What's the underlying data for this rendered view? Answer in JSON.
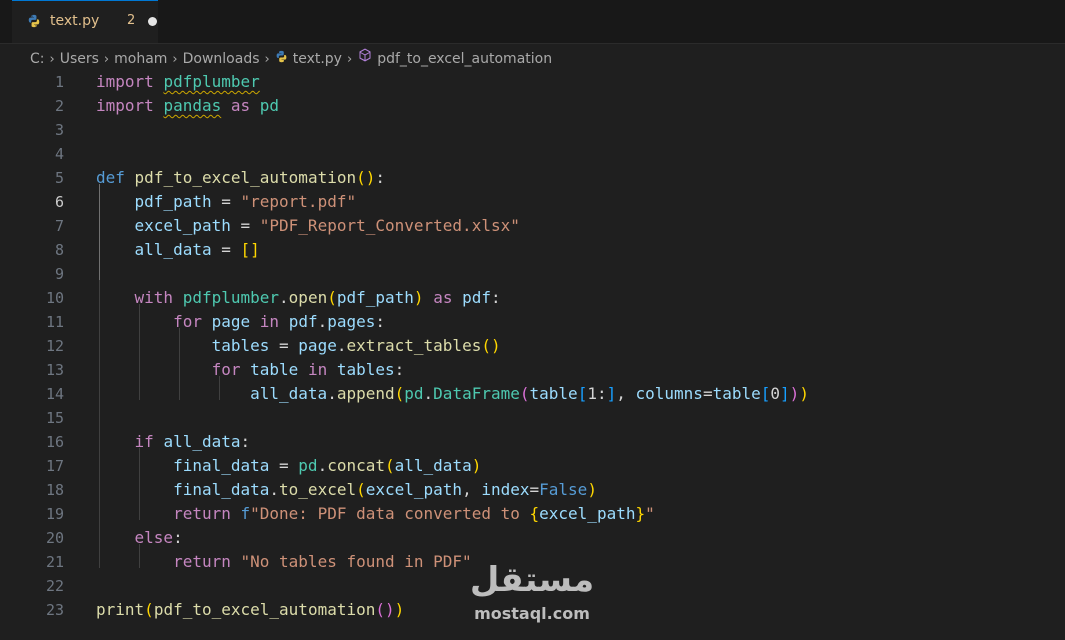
{
  "tab": {
    "filename": "text.py",
    "problem_count": "2"
  },
  "breadcrumb": {
    "items": [
      "C:",
      "Users",
      "moham",
      "Downloads",
      "text.py",
      "pdf_to_excel_automation"
    ]
  },
  "editor": {
    "active_line": 6,
    "line_numbers": [
      "1",
      "2",
      "3",
      "4",
      "5",
      "6",
      "7",
      "8",
      "9",
      "10",
      "11",
      "12",
      "13",
      "14",
      "15",
      "16",
      "17",
      "18",
      "19",
      "20",
      "21",
      "22",
      "23"
    ],
    "lines": [
      [
        [
          "kw",
          "import"
        ],
        [
          "op",
          " "
        ],
        [
          "mod squig",
          "pdfplumber"
        ]
      ],
      [
        [
          "kw",
          "import"
        ],
        [
          "op",
          " "
        ],
        [
          "mod squig",
          "pandas"
        ],
        [
          "op",
          " "
        ],
        [
          "kw",
          "as"
        ],
        [
          "op",
          " "
        ],
        [
          "mod",
          "pd"
        ]
      ],
      [],
      [],
      [
        [
          "def",
          "def"
        ],
        [
          "op",
          " "
        ],
        [
          "fn",
          "pdf_to_excel_automation"
        ],
        [
          "br1",
          "()"
        ],
        [
          "op",
          ":"
        ]
      ],
      [
        [
          "op",
          "    "
        ],
        [
          "var",
          "pdf_path"
        ],
        [
          "op",
          " = "
        ],
        [
          "str",
          "\"report.pdf\""
        ]
      ],
      [
        [
          "op",
          "    "
        ],
        [
          "var",
          "excel_path"
        ],
        [
          "op",
          " = "
        ],
        [
          "str",
          "\"PDF_Report_Converted.xlsx\""
        ]
      ],
      [
        [
          "op",
          "    "
        ],
        [
          "var",
          "all_data"
        ],
        [
          "op",
          " = "
        ],
        [
          "br1",
          "[]"
        ]
      ],
      [],
      [
        [
          "op",
          "    "
        ],
        [
          "kw",
          "with"
        ],
        [
          "op",
          " "
        ],
        [
          "mod",
          "pdfplumber"
        ],
        [
          "op",
          "."
        ],
        [
          "fn",
          "open"
        ],
        [
          "br1",
          "("
        ],
        [
          "var",
          "pdf_path"
        ],
        [
          "br1",
          ")"
        ],
        [
          "op",
          " "
        ],
        [
          "kw",
          "as"
        ],
        [
          "op",
          " "
        ],
        [
          "var",
          "pdf"
        ],
        [
          "op",
          ":"
        ]
      ],
      [
        [
          "op",
          "        "
        ],
        [
          "kw",
          "for"
        ],
        [
          "op",
          " "
        ],
        [
          "var",
          "page"
        ],
        [
          "op",
          " "
        ],
        [
          "kw",
          "in"
        ],
        [
          "op",
          " "
        ],
        [
          "var",
          "pdf"
        ],
        [
          "op",
          "."
        ],
        [
          "var",
          "pages"
        ],
        [
          "op",
          ":"
        ]
      ],
      [
        [
          "op",
          "            "
        ],
        [
          "var",
          "tables"
        ],
        [
          "op",
          " = "
        ],
        [
          "var",
          "page"
        ],
        [
          "op",
          "."
        ],
        [
          "fn",
          "extract_tables"
        ],
        [
          "br1",
          "()"
        ]
      ],
      [
        [
          "op",
          "            "
        ],
        [
          "kw",
          "for"
        ],
        [
          "op",
          " "
        ],
        [
          "var",
          "table"
        ],
        [
          "op",
          " "
        ],
        [
          "kw",
          "in"
        ],
        [
          "op",
          " "
        ],
        [
          "var",
          "tables"
        ],
        [
          "op",
          ":"
        ]
      ],
      [
        [
          "op",
          "                "
        ],
        [
          "var",
          "all_data"
        ],
        [
          "op",
          "."
        ],
        [
          "fn",
          "append"
        ],
        [
          "br1",
          "("
        ],
        [
          "mod",
          "pd"
        ],
        [
          "op",
          "."
        ],
        [
          "mod",
          "DataFrame"
        ],
        [
          "br2",
          "("
        ],
        [
          "var",
          "table"
        ],
        [
          "br3",
          "["
        ],
        [
          "op",
          "1:"
        ],
        [
          "br3",
          "]"
        ],
        [
          "op",
          ", "
        ],
        [
          "var",
          "columns"
        ],
        [
          "op",
          "="
        ],
        [
          "var",
          "table"
        ],
        [
          "br3",
          "["
        ],
        [
          "op",
          "0"
        ],
        [
          "br3",
          "]"
        ],
        [
          "br2",
          ")"
        ],
        [
          "br1",
          ")"
        ]
      ],
      [],
      [
        [
          "op",
          "    "
        ],
        [
          "kw",
          "if"
        ],
        [
          "op",
          " "
        ],
        [
          "var",
          "all_data"
        ],
        [
          "op",
          ":"
        ]
      ],
      [
        [
          "op",
          "        "
        ],
        [
          "var",
          "final_data"
        ],
        [
          "op",
          " = "
        ],
        [
          "mod",
          "pd"
        ],
        [
          "op",
          "."
        ],
        [
          "fn",
          "concat"
        ],
        [
          "br1",
          "("
        ],
        [
          "var",
          "all_data"
        ],
        [
          "br1",
          ")"
        ]
      ],
      [
        [
          "op",
          "        "
        ],
        [
          "var",
          "final_data"
        ],
        [
          "op",
          "."
        ],
        [
          "fn",
          "to_excel"
        ],
        [
          "br1",
          "("
        ],
        [
          "var",
          "excel_path"
        ],
        [
          "op",
          ", "
        ],
        [
          "var",
          "index"
        ],
        [
          "op",
          "="
        ],
        [
          "const",
          "False"
        ],
        [
          "br1",
          ")"
        ]
      ],
      [
        [
          "op",
          "        "
        ],
        [
          "kw",
          "return"
        ],
        [
          "op",
          " "
        ],
        [
          "def",
          "f"
        ],
        [
          "str",
          "\"Done: PDF data converted to "
        ],
        [
          "br1",
          "{"
        ],
        [
          "var",
          "excel_path"
        ],
        [
          "br1",
          "}"
        ],
        [
          "str",
          "\""
        ]
      ],
      [
        [
          "op",
          "    "
        ],
        [
          "kw",
          "else"
        ],
        [
          "op",
          ":"
        ]
      ],
      [
        [
          "op",
          "        "
        ],
        [
          "kw",
          "return"
        ],
        [
          "op",
          " "
        ],
        [
          "str",
          "\"No tables found in PDF\""
        ]
      ],
      [],
      [
        [
          "fn",
          "print"
        ],
        [
          "br1",
          "("
        ],
        [
          "fn",
          "pdf_to_excel_automation"
        ],
        [
          "br2",
          "()"
        ],
        [
          "br1",
          ")"
        ]
      ]
    ]
  },
  "watermark": {
    "arabic": "مستقل",
    "latin": "mostaql.com"
  },
  "colors": {
    "accent": "#0078d4",
    "modified": "#e2c08d",
    "background": "#1f1f1f"
  }
}
